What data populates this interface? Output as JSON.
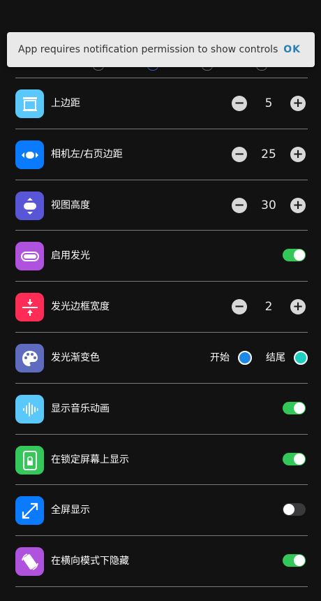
{
  "toast": {
    "message": "App requires notification permission to show controls",
    "action": "OK"
  },
  "settings": [
    {
      "type": "stepper",
      "label": "上边距",
      "value": "5",
      "icon": "top-margin-icon",
      "icon_color": "#5ac8fa"
    },
    {
      "type": "stepper",
      "label": "相机左/右页边距",
      "value": "25",
      "icon": "horizontal-margin-icon",
      "icon_color": "#0a7aff"
    },
    {
      "type": "stepper",
      "label": "视图高度",
      "value": "30",
      "icon": "view-height-icon",
      "icon_color": "#5856d6"
    },
    {
      "type": "toggle",
      "label": "启用发光",
      "value": true,
      "icon": "glow-icon",
      "icon_color": "#af52de"
    },
    {
      "type": "stepper",
      "label": "发光边框宽度",
      "value": "2",
      "icon": "border-width-icon",
      "icon_color": "#ff2d55"
    },
    {
      "type": "gradient",
      "label": "发光渐变色",
      "start_label": "开始",
      "end_label": "结尾",
      "start_color": "#1e88e5",
      "end_color": "#1ccfc0",
      "icon": "palette-icon",
      "icon_color": "#5e6bbf"
    },
    {
      "type": "toggle",
      "label": "显示音乐动画",
      "value": true,
      "icon": "waveform-icon",
      "icon_color": "#5ac8fa"
    },
    {
      "type": "toggle",
      "label": "在锁定屏幕上显示",
      "value": true,
      "icon": "lock-screen-icon",
      "icon_color": "#34c759"
    },
    {
      "type": "toggle",
      "label": "全屏显示",
      "value": false,
      "icon": "fullscreen-icon",
      "icon_color": "#0a7aff"
    },
    {
      "type": "toggle",
      "label": "在横向模式下隐藏",
      "value": true,
      "icon": "rotate-icon",
      "icon_color": "#af52de"
    }
  ],
  "colors": {
    "toggle_on": "#33c759",
    "toggle_off": "#3a3a3c",
    "separator": "#7a7a7a"
  }
}
